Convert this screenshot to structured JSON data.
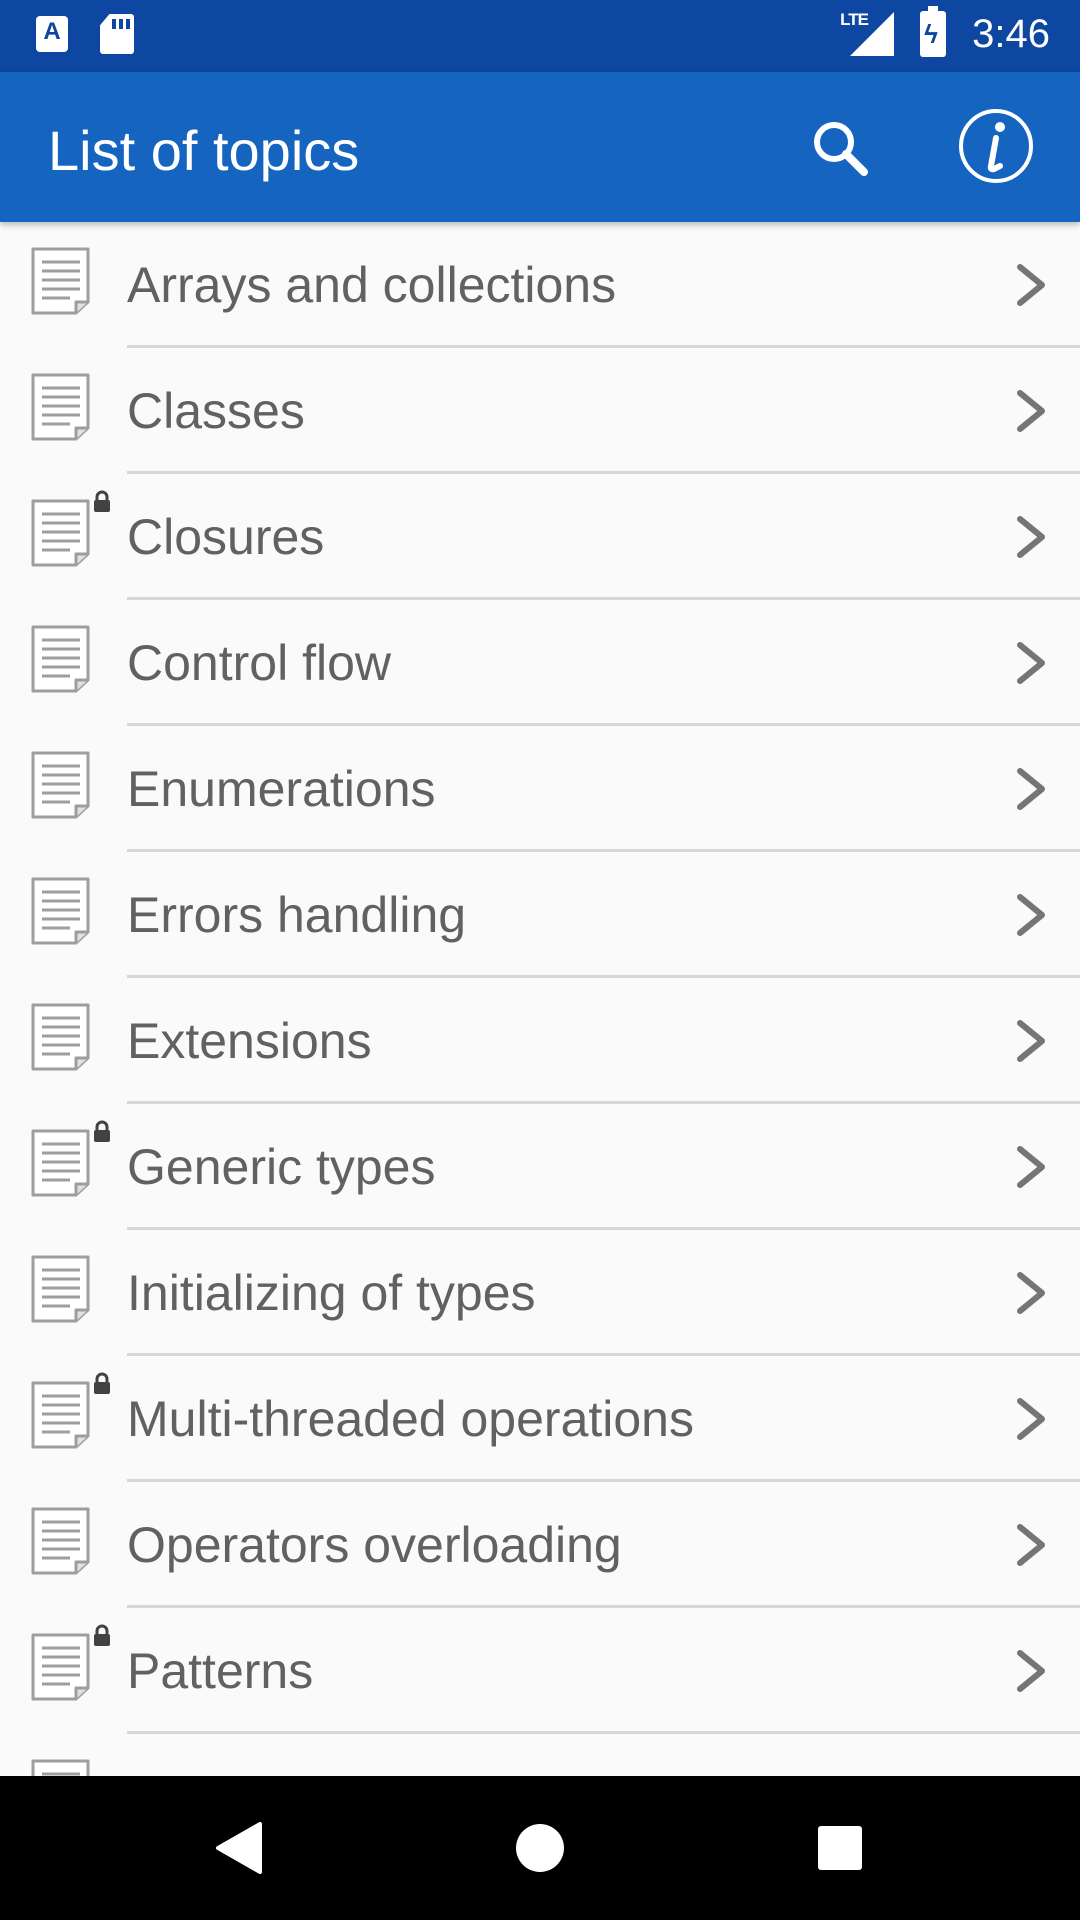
{
  "status_bar": {
    "time": "3:46",
    "network": "LTE"
  },
  "app_bar": {
    "title": "List of topics",
    "search_icon": "search-icon",
    "info_icon": "info-icon"
  },
  "colors": {
    "status_bar": "#0d47a1",
    "app_bar": "#1565c0",
    "text": "#616161",
    "divider": "#d6d6d6"
  },
  "topics": [
    {
      "label": "Arrays and collections",
      "locked": false
    },
    {
      "label": "Classes",
      "locked": false
    },
    {
      "label": "Closures",
      "locked": true
    },
    {
      "label": "Control flow",
      "locked": false
    },
    {
      "label": "Enumerations",
      "locked": false
    },
    {
      "label": "Errors handling",
      "locked": false
    },
    {
      "label": "Extensions",
      "locked": false
    },
    {
      "label": "Generic types",
      "locked": true
    },
    {
      "label": "Initializing of types",
      "locked": false
    },
    {
      "label": "Multi-threaded operations",
      "locked": true
    },
    {
      "label": "Operators overloading",
      "locked": false
    },
    {
      "label": "Patterns",
      "locked": true
    }
  ]
}
